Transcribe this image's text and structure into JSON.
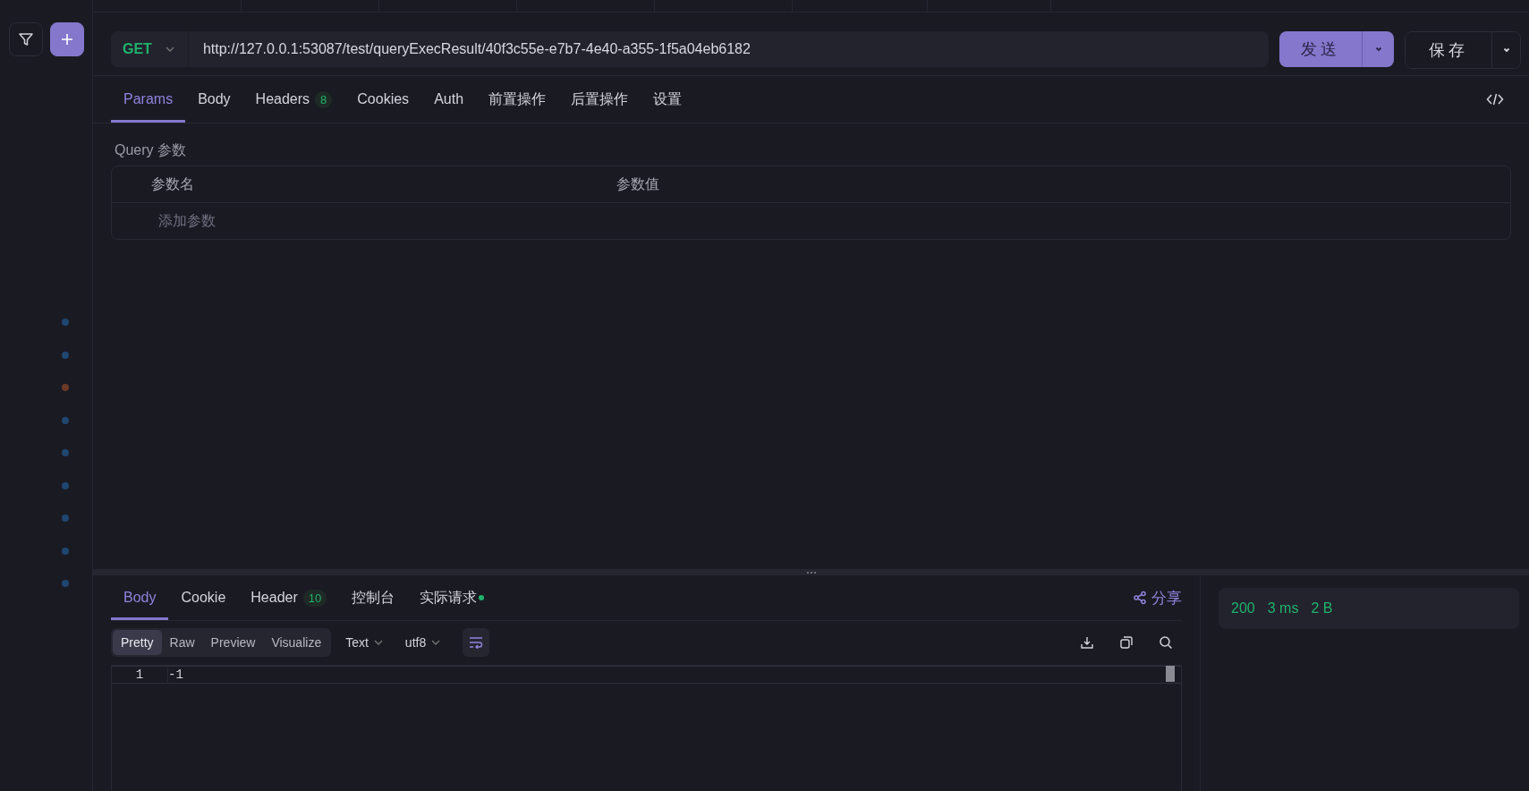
{
  "sidebar": {
    "markers": [
      {
        "color": "#1f4670"
      },
      {
        "color": "#1f4670"
      },
      {
        "color": "#6b3a26"
      },
      {
        "color": "#1f4670"
      },
      {
        "color": "#1f4670"
      },
      {
        "color": "#1f4670"
      },
      {
        "color": "#1f4670"
      },
      {
        "color": "#1f4670"
      },
      {
        "color": "#1f4670"
      }
    ]
  },
  "request": {
    "method": "GET",
    "url": "http://127.0.0.1:53087/test/queryExecResult/40f3c55e-e7b7-4e40-a355-1f5a04eb6182",
    "send_label": "发送",
    "save_label": "保存"
  },
  "request_tabs": [
    {
      "label": "Params",
      "selected": true
    },
    {
      "label": "Body",
      "selected": false
    },
    {
      "label": "Headers",
      "badge": "8",
      "selected": false
    },
    {
      "label": "Cookies",
      "selected": false
    },
    {
      "label": "Auth",
      "selected": false
    },
    {
      "label": "前置操作",
      "selected": false
    },
    {
      "label": "后置操作",
      "selected": false
    },
    {
      "label": "设置",
      "selected": false
    }
  ],
  "params": {
    "section_title": "Query 参数",
    "columns": [
      "参数名",
      "参数值"
    ],
    "placeholder": "添加参数"
  },
  "response_tabs": [
    {
      "label": "Body",
      "selected": true
    },
    {
      "label": "Cookie",
      "selected": false
    },
    {
      "label": "Header",
      "badge": "10",
      "selected": false
    },
    {
      "label": "控制台",
      "selected": false
    },
    {
      "label": "实际请求",
      "selected": false,
      "dot": true
    }
  ],
  "share_label": "分享",
  "view_modes": [
    {
      "label": "Pretty",
      "selected": true
    },
    {
      "label": "Raw",
      "selected": false
    },
    {
      "label": "Preview",
      "selected": false
    },
    {
      "label": "Visualize",
      "selected": false
    }
  ],
  "format": "Text",
  "encoding": "utf8",
  "editor": {
    "lines": [
      {
        "number": "1",
        "text": "-1"
      }
    ]
  },
  "status": {
    "code": "200",
    "time": "3 ms",
    "size": "2 B"
  }
}
